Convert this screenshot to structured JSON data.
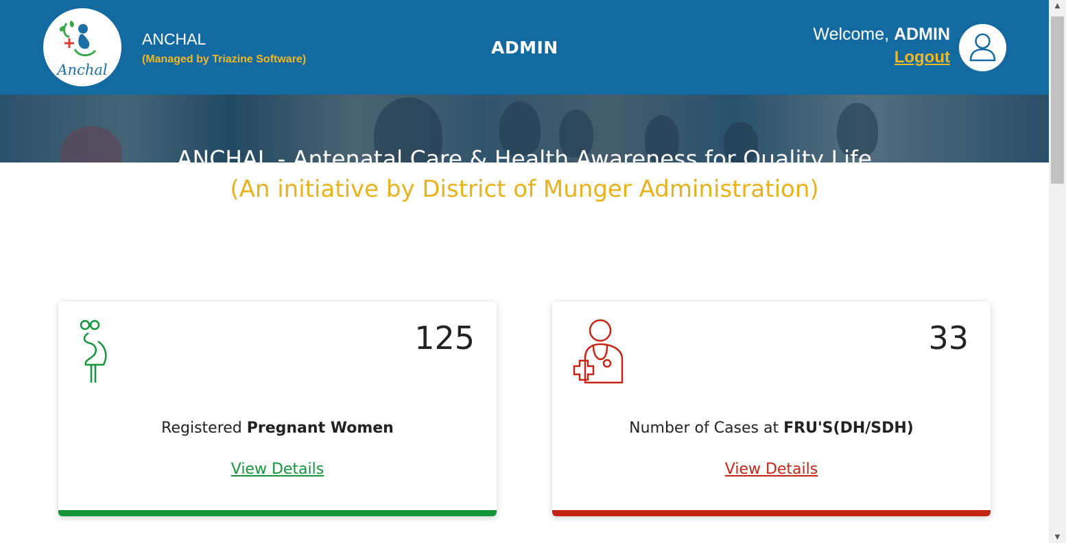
{
  "header": {
    "logo_text": "Anchal",
    "brand_name": "ANCHAL",
    "brand_sub": "(Managed by Triazine Software)",
    "center_title": "ADMIN",
    "welcome_prefix": "Welcome, ",
    "welcome_user": "ADMIN",
    "logout_label": "Logout"
  },
  "banner": {
    "title": "ANCHAL - Antenatal Care & Health Awareness for Quality Life",
    "subtitle": "(An initiative by District of Munger Administration)"
  },
  "cards": [
    {
      "count": "125",
      "label_prefix": "Registered ",
      "label_bold": "Pregnant Women",
      "link": "View Details",
      "icon": "pregnant-woman-icon",
      "color": "#14953b"
    },
    {
      "count": "33",
      "label_prefix": "Number of Cases at ",
      "label_bold": "FRU'S(DH/SDH)",
      "link": "View Details",
      "icon": "doctor-icon",
      "color": "#c42414"
    }
  ],
  "colors": {
    "header_bg": "#136aa0",
    "accent_yellow": "#f2b824",
    "green": "#14953b",
    "red": "#c42414"
  }
}
